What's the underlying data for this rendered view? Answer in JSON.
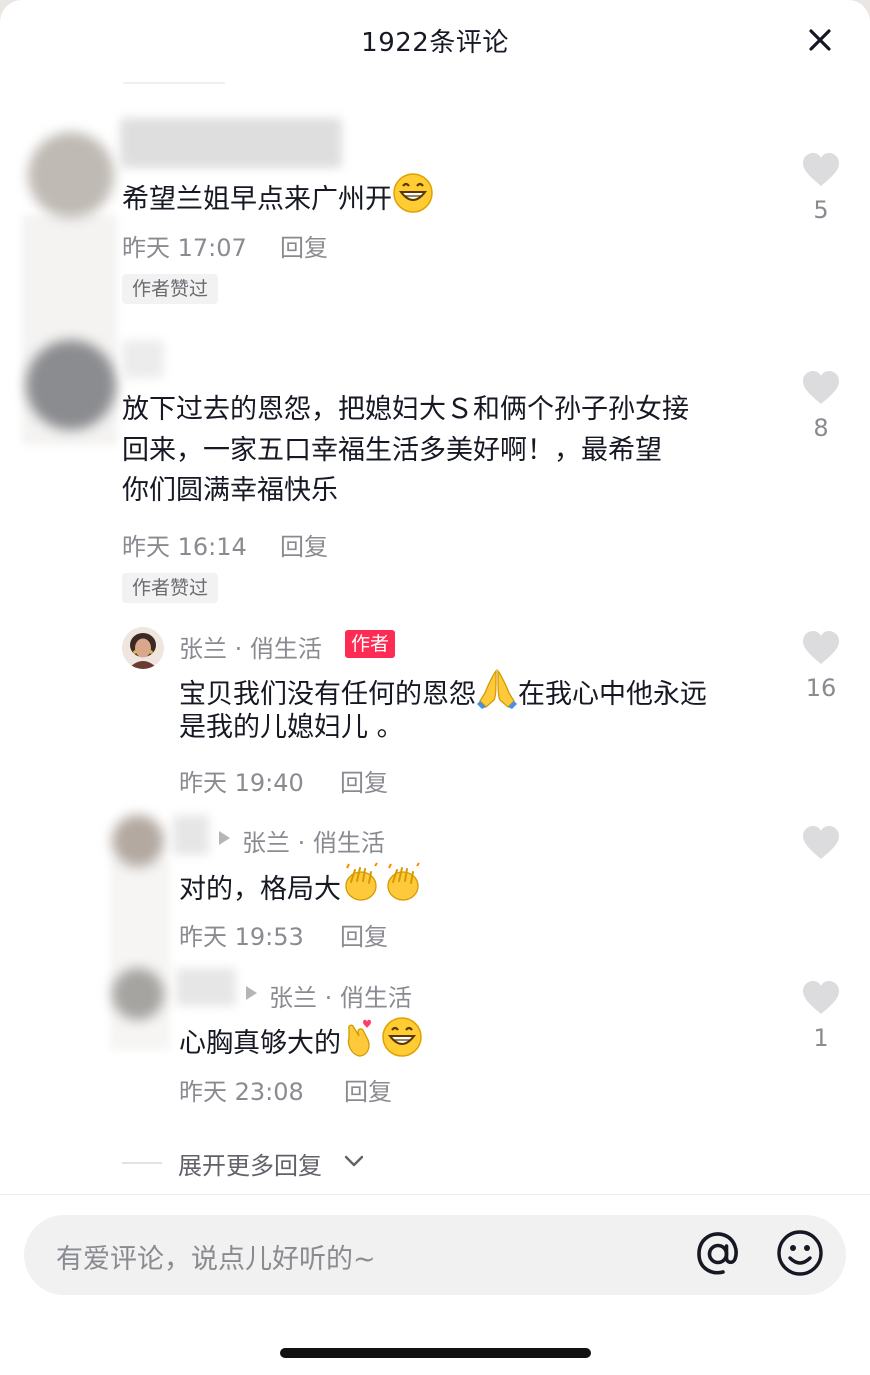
{
  "header": {
    "title": "1922条评论"
  },
  "comments": [
    {
      "text": "希望兰姐早点来广州开",
      "time": "昨天 17:07",
      "reply_label": "回复",
      "badge": "作者赞过",
      "likes": "5",
      "emoji": "grinning-face"
    },
    {
      "lines": [
        "放下过去的恩怨，把媳妇大Ｓ和俩个孙子孙女接",
        "回来，一家五口幸福生活多美好啊！，最希望",
        "你们圆满幸福快乐"
      ],
      "time": "昨天 16:14",
      "reply_label": "回复",
      "badge": "作者赞过",
      "likes": "8"
    }
  ],
  "replies": [
    {
      "author": "张兰 · 俏生活",
      "author_tag": "作者",
      "lines": [
        "宝贝我们没有任何的恩怨",
        "在我心中他永远",
        "是我的儿媳妇儿 。"
      ],
      "emoji": "folded-hands",
      "time": "昨天 19:40",
      "reply_label": "回复",
      "likes": "16"
    },
    {
      "reply_to": "张兰 · 俏生活",
      "text": "对的，格局大",
      "emoji": "clapping-hands",
      "time": "昨天 19:53",
      "reply_label": "回复",
      "likes": ""
    },
    {
      "reply_to": "张兰 · 俏生活",
      "text": "心胸真够大的",
      "emoji": "finger-heart, grinning-face",
      "time": "昨天 23:08",
      "reply_label": "回复",
      "likes": "1"
    }
  ],
  "expand": {
    "label": "展开更多回复"
  },
  "input": {
    "placeholder": "有爱评论，说点儿好听的~"
  },
  "icons": {
    "close": "close-icon",
    "like": "heart-icon",
    "mention": "at-icon",
    "emoji": "smiley-icon",
    "chevron": "chevron-down-icon"
  },
  "colors": {
    "author_tag": "#fe2c55",
    "like_heart": "#dcdcde",
    "secondary_text": "#8a8b91"
  }
}
